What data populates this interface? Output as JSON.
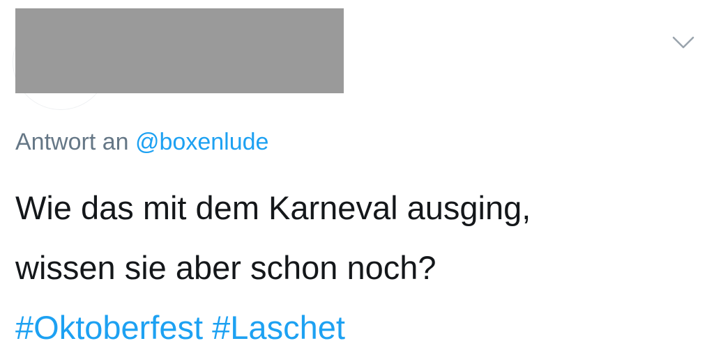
{
  "tweet": {
    "reply_prefix": "Antwort an",
    "reply_handle": "@boxenlude",
    "text_line_1": "Wie das mit dem Karneval ausging,",
    "text_line_2": "wissen sie aber schon noch?",
    "hashtags": [
      "#Oktoberfest",
      "#Laschet"
    ]
  },
  "icons": {
    "menu": "chevron-down-icon"
  },
  "colors": {
    "link": "#1da1f2",
    "secondary_text": "#657786",
    "primary_text": "#14171a",
    "redaction": "#9a9a9a"
  }
}
